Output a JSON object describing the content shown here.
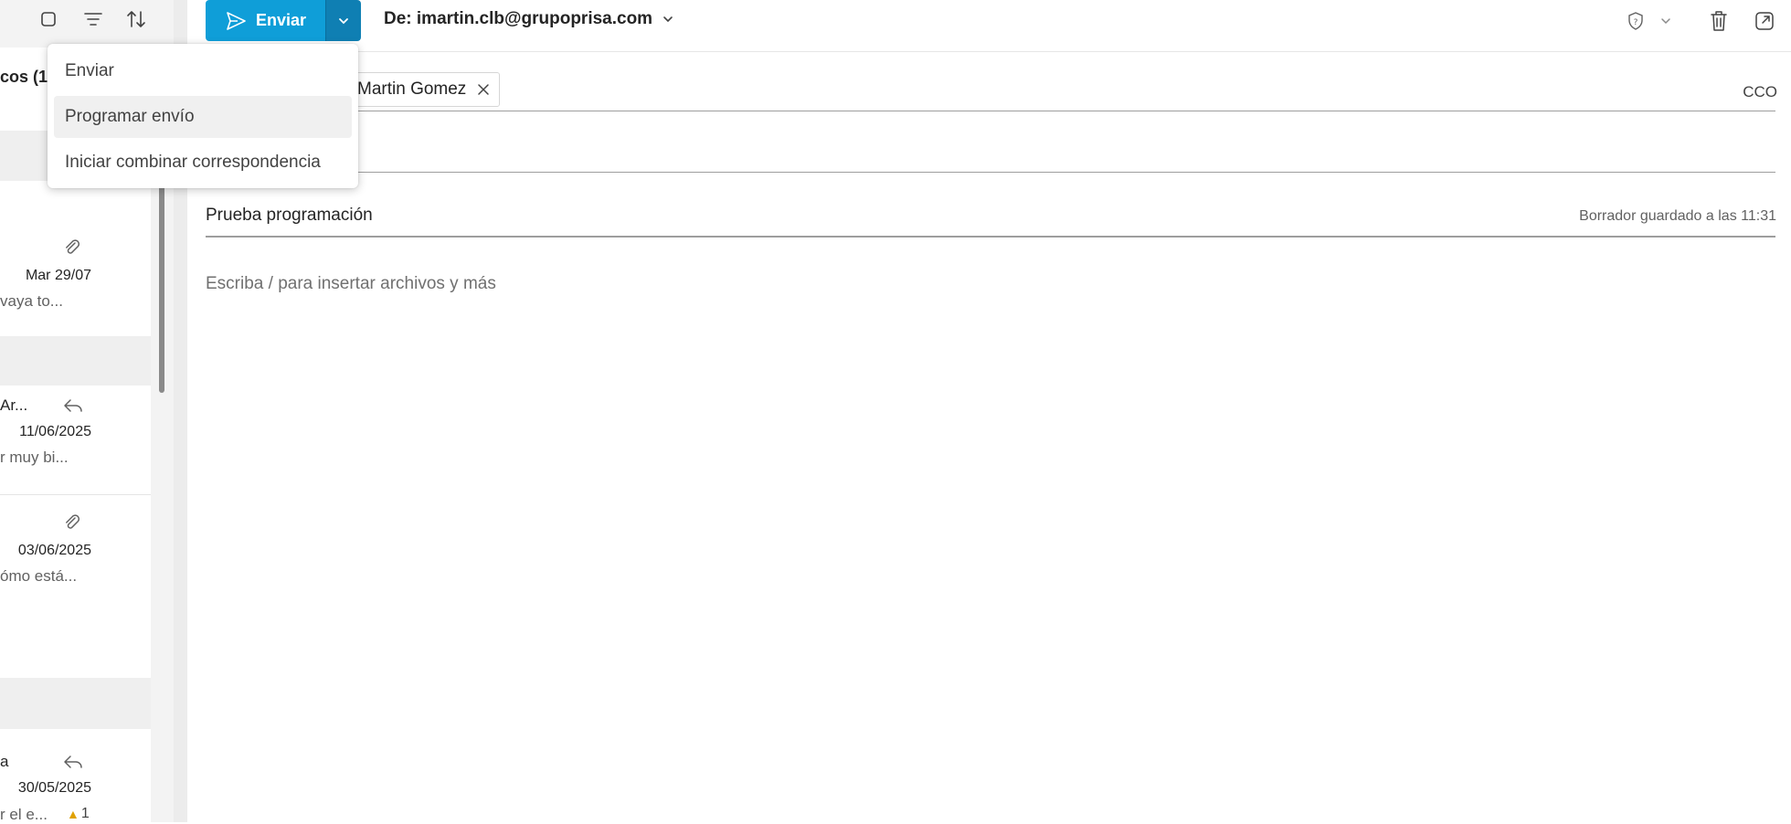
{
  "list": {
    "folder_label": "cos (1)",
    "items": [
      {
        "date": "Mar 29/07",
        "preview": "vaya to...",
        "icon": "paperclip-icon"
      },
      {
        "subject": "Ar...",
        "date": "11/06/2025",
        "preview": "r muy bi...",
        "icon": "reply-icon"
      },
      {
        "date": "03/06/2025",
        "preview": "ómo está...",
        "icon": "paperclip-icon"
      },
      {
        "subject": "a",
        "date": "30/05/2025",
        "preview": "r el e...",
        "reaction_count": "1",
        "icon": "reply-icon"
      }
    ]
  },
  "toolbar": {
    "send_label": "Enviar",
    "from_label": "De: imartin.clb@grupoprisa.com"
  },
  "send_menu": {
    "items": [
      {
        "label": "Enviar"
      },
      {
        "label": "Programar envío"
      },
      {
        "label": "Iniciar combinar correspondencia"
      }
    ]
  },
  "compose": {
    "recipient_name": "Martin Gomez",
    "cco_label": "CCO",
    "subject": "Prueba programación",
    "draft_status": "Borrador guardado a las 11:31",
    "body_placeholder": "Escriba / para insertar archivos y más"
  },
  "colors": {
    "accent": "#0f9ed8",
    "accent_dark": "#0f7fb3"
  }
}
